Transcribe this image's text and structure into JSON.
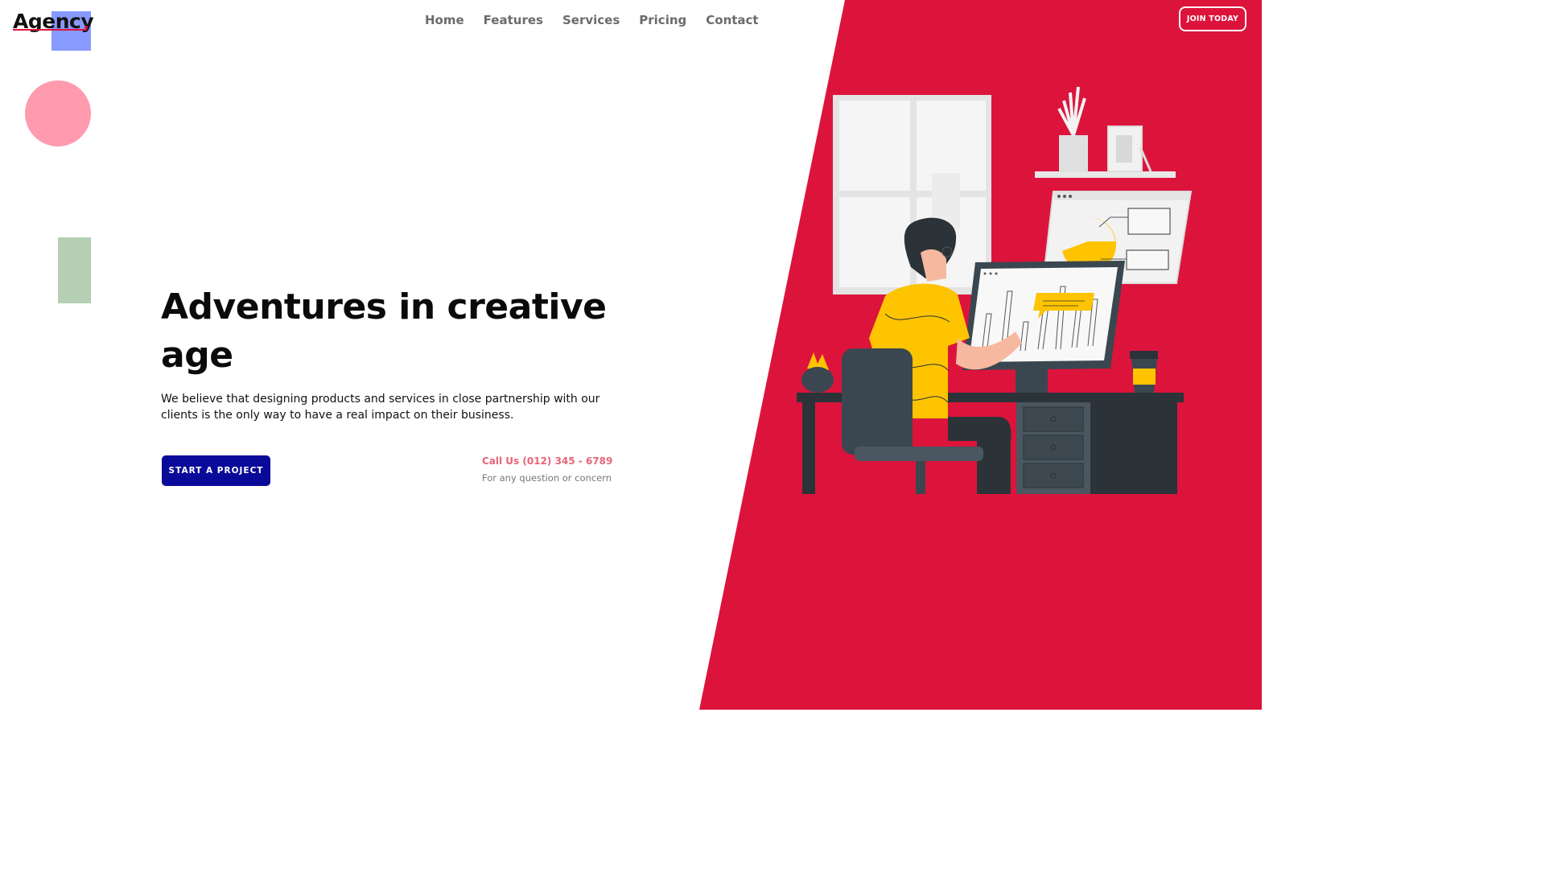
{
  "brand": {
    "logo_text": "Agency"
  },
  "nav": {
    "items": [
      {
        "label": "Home"
      },
      {
        "label": "Features"
      },
      {
        "label": "Services"
      },
      {
        "label": "Pricing"
      },
      {
        "label": "Contact"
      }
    ],
    "join_label": "JOIN TODAY"
  },
  "hero": {
    "title": "Adventures in creative age",
    "description": "We believe that designing products and services in close partnership with our clients is the only way to have a real impact on their business.",
    "cta_label": "START A PROJECT",
    "call_label": "Call Us (012) 345 - 6789",
    "call_sub": "For any question or concern"
  },
  "colors": {
    "accent_red": "#dc143c",
    "cta_blue": "#0a0a9a",
    "deco_blue": "#8899ff",
    "deco_pink": "#ff9aaf",
    "deco_green": "#b4cfb4",
    "illustration_yellow": "#fec400",
    "illustration_dark": "#3a4750"
  },
  "icons": {
    "illustration": "person-at-computer-illustration"
  }
}
